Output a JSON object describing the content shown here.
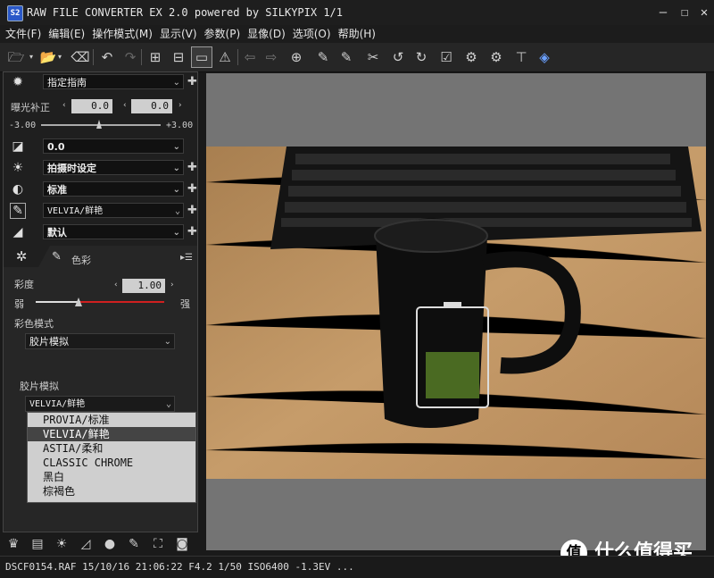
{
  "window": {
    "title": "RAW FILE CONVERTER EX 2.0 powered by SILKYPIX    1/1",
    "minimize": "—",
    "maximize": "☐",
    "close": "✕",
    "app_icon": "S2"
  },
  "menu": [
    "文件(F)",
    "编辑(E)",
    "操作模式(M)",
    "显示(V)",
    "参数(P)",
    "显像(D)",
    "选项(O)",
    "帮助(H)"
  ],
  "panel": {
    "preset": "指定指南",
    "exposure_label": "曝光补正",
    "exposure_value_1": "0.0",
    "exposure_value_2": "0.0",
    "exposure_min": "-3.00",
    "exposure_max": "+3.00",
    "tone_value": "0.0",
    "wb_value": "拍摄时设定",
    "contrast_value": "标准",
    "film_value": "VELVIA/鲜艳",
    "sharp_value": "默认",
    "tab_color_label": "色彩",
    "saturation_label": "彩度",
    "saturation_value": "1.00",
    "sat_low": "弱",
    "sat_high": "强",
    "color_mode_label": "彩色模式",
    "color_mode_value": "胶片模拟",
    "film_sim_label": "胶片模拟",
    "film_sim_value": "VELVIA/鲜艳",
    "film_options": [
      "PROVIA/标准",
      "VELVIA/鲜艳",
      "ASTIA/柔和",
      "CLASSIC CHROME",
      "黑白",
      "棕褐色"
    ],
    "film_selected_index": 1
  },
  "status": {
    "text": "DSCF0154.RAF 15/10/16 21:06:22 F4.2 1/50 ISO6400 -1.3EV ..."
  },
  "watermark": {
    "logo": "值",
    "text": "什么值得买"
  },
  "colors": {
    "accent_red": "#d02020",
    "viewer_bg": "#747474"
  }
}
